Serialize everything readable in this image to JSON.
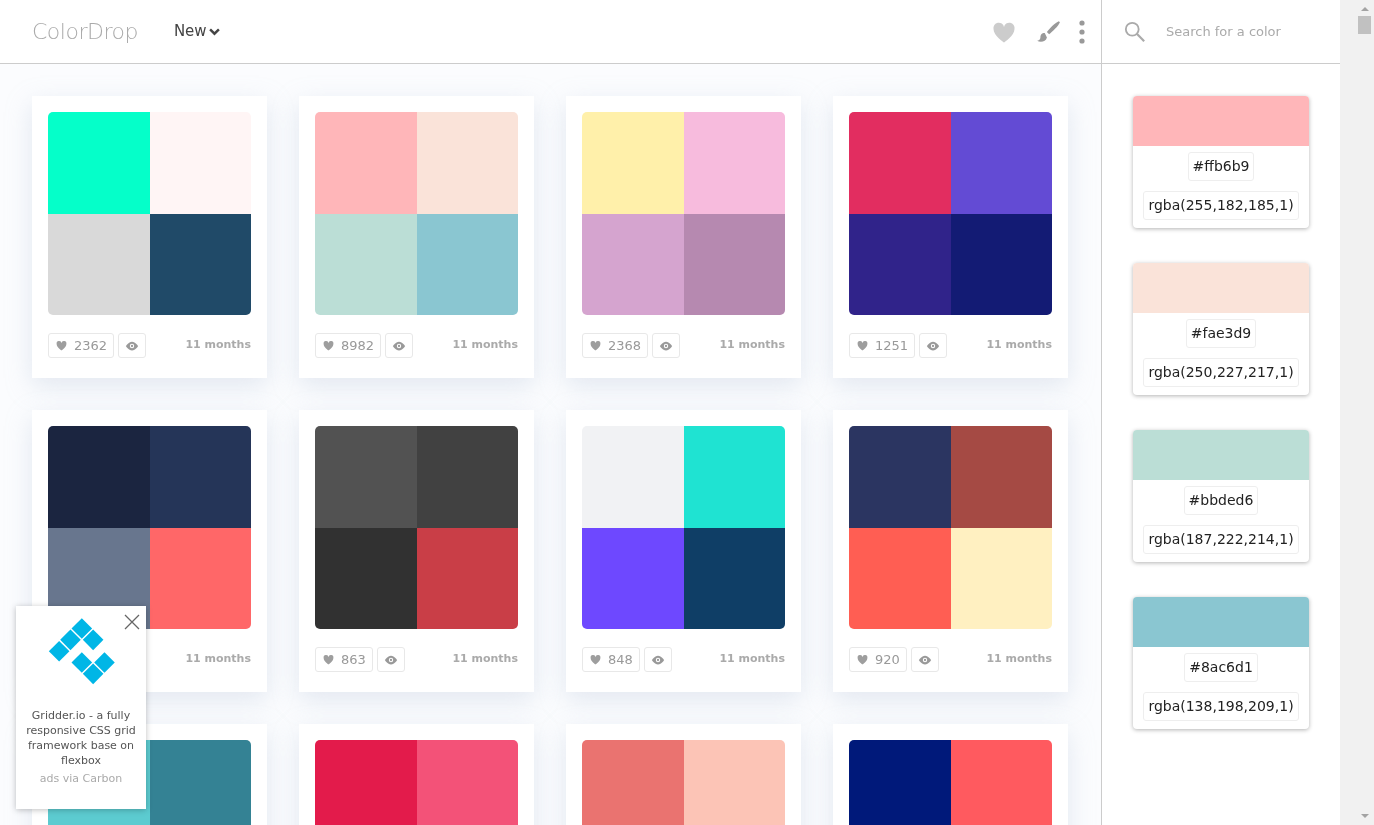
{
  "header": {
    "logo": "ColorDrop",
    "sort_menu": {
      "label": "New"
    }
  },
  "search": {
    "placeholder": "Search for a color"
  },
  "palettes": [
    {
      "colors": [
        {
          "color": "#05ffc9"
        },
        {
          "color": "#fff5f5"
        },
        {
          "color": "#d9d9d9"
        },
        {
          "color": "#204a68"
        }
      ],
      "likes": "2362",
      "time": "11 months"
    },
    {
      "colors": [
        {
          "color": "#ffb6b9"
        },
        {
          "color": "#fae3d9"
        },
        {
          "color": "#bbded6"
        },
        {
          "color": "#8ac6d1"
        }
      ],
      "likes": "8982",
      "time": "11 months"
    },
    {
      "colors": [
        {
          "color": "#fff0aa"
        },
        {
          "color": "#f7bbdd"
        },
        {
          "color": "#d5a4cf"
        },
        {
          "color": "#b689b0"
        }
      ],
      "likes": "2368",
      "time": "11 months"
    },
    {
      "colors": [
        {
          "color": "#e22d60"
        },
        {
          "color": "#634bd4"
        },
        {
          "color": "#30238a"
        },
        {
          "color": "#131b74"
        }
      ],
      "likes": "1251",
      "time": "11 months"
    },
    {
      "colors": [
        {
          "color": "#1b2540"
        },
        {
          "color": "#253558"
        },
        {
          "color": "#68768e"
        },
        {
          "color": "#ff6768"
        }
      ],
      "time": "11 months"
    },
    {
      "colors": [
        {
          "color": "#525252"
        },
        {
          "color": "#414141"
        },
        {
          "color": "#313131"
        },
        {
          "color": "#c93e47"
        }
      ],
      "likes": "863",
      "time": "11 months"
    },
    {
      "colors": [
        {
          "color": "#f1f2f4"
        },
        {
          "color": "#1fe3d2"
        },
        {
          "color": "#6e48ff"
        },
        {
          "color": "#0f3e66"
        }
      ],
      "likes": "848",
      "time": "11 months"
    },
    {
      "colors": [
        {
          "color": "#2b3561"
        },
        {
          "color": "#a54a44"
        },
        {
          "color": "#ff5e53"
        },
        {
          "color": "#fff0c1"
        }
      ],
      "likes": "920",
      "time": "11 months"
    },
    {
      "colors": [
        {
          "color": "#5ccbd0"
        },
        {
          "color": "#348294"
        }
      ]
    },
    {
      "colors": [
        {
          "color": "#e31b4b"
        },
        {
          "color": "#f35278"
        }
      ]
    },
    {
      "colors": [
        {
          "color": "#ea7370"
        },
        {
          "color": "#fcc4b6"
        }
      ]
    },
    {
      "colors": [
        {
          "color": "#00197a"
        },
        {
          "color": "#ff5a5f"
        }
      ]
    }
  ],
  "selected_colors": [
    {
      "color": "#ffb6b9",
      "hex": "#ffb6b9",
      "rgba": "rgba(255,182,185,1)"
    },
    {
      "color": "#fae3d9",
      "hex": "#fae3d9",
      "rgba": "rgba(250,227,217,1)"
    },
    {
      "color": "#bbded6",
      "hex": "#bbded6",
      "rgba": "rgba(187,222,214,1)"
    },
    {
      "color": "#8ac6d1",
      "hex": "#8ac6d1",
      "rgba": "rgba(138,198,209,1)"
    }
  ],
  "ad": {
    "text": "Gridder.io - a fully responsive CSS grid framework base on flexbox",
    "credit": "ads via Carbon"
  }
}
